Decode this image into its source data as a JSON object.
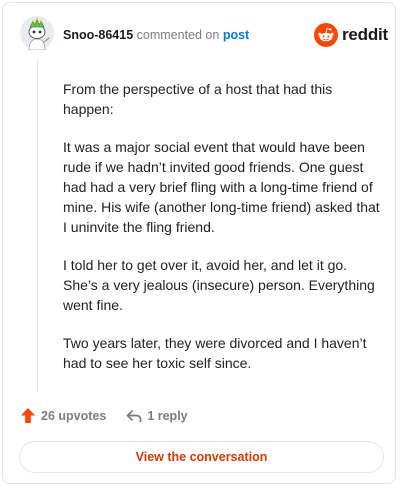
{
  "header": {
    "username": "Snoo-86415",
    "action_text": "commented on",
    "post_link": "post",
    "brand": "reddit"
  },
  "comment": {
    "paragraphs": [
      "From the perspective of a host that had this happen:",
      "It was a major social event that would have been rude if we hadn’t invited good friends. One guest had had a very brief fling with a long-time friend of mine. His wife (another long-time friend) asked that I uninvite the fling friend.",
      "I told her to get over it, avoid her, and let it go. She’s a very jealous (insecure) person. Everything went fine.",
      "Two years later, they were divorced and I haven’t had to see her toxic self since."
    ]
  },
  "footer": {
    "upvotes_label": "26 upvotes",
    "reply_label": "1 reply",
    "view_button": "View the conversation"
  },
  "colors": {
    "brand_orange": "#ff4500",
    "link_blue": "#0079d3",
    "button_text": "#d93a00",
    "muted_text": "#7c7c83"
  },
  "icons": {
    "avatar": "snoo-avatar",
    "logo": "reddit-alien-logo",
    "upvote": "upvote-arrow-icon",
    "reply": "reply-arrow-icon"
  }
}
